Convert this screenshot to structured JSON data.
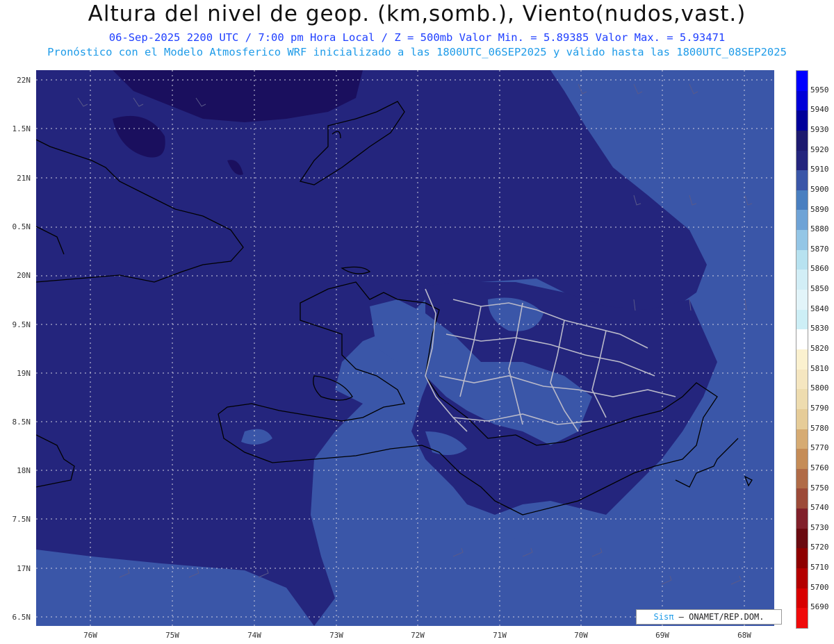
{
  "title": "Altura del nivel de geop. (km,somb.), Viento(nudos,vast.)",
  "subtitle_line1": "06-Sep-2025  2200 UTC / 7:00 pm Hora Local / Z = 500mb    Valor Min. = 5.89385  Valor Max. = 5.93471",
  "subtitle_line2": "Pronóstico con el Modelo Atmosferico WRF inicializado a las 1800UTC_06SEP2025 y válido hasta las  1800UTC_08SEP2025",
  "latitude_labels": [
    "22N",
    "1.5N",
    "21N",
    "0.5N",
    "20N",
    "9.5N",
    "19N",
    "8.5N",
    "18N",
    "7.5N",
    "17N",
    "6.5N"
  ],
  "longitude_labels": [
    "76W",
    "75W",
    "74W",
    "73W",
    "72W",
    "71W",
    "70W",
    "69W",
    "68W"
  ],
  "colorbar": {
    "levels": [
      "5950",
      "5940",
      "5930",
      "5920",
      "5910",
      "5900",
      "5890",
      "5880",
      "5870",
      "5860",
      "5850",
      "5840",
      "5830",
      "5820",
      "5810",
      "5800",
      "5790",
      "5780",
      "5770",
      "5760",
      "5750",
      "5740",
      "5730",
      "5720",
      "5710",
      "5700",
      "5690"
    ],
    "colors": [
      "#0000ff",
      "#0000d8",
      "#00009a",
      "#1d1a6f",
      "#24257d",
      "#3a56a8",
      "#4a7fc0",
      "#6fa3d6",
      "#94c6e6",
      "#b7e2f0",
      "#d2eef6",
      "#e2f4f9",
      "#cdeff6",
      "#ffffff",
      "#fbf1cf",
      "#f5e6c0",
      "#eedcaf",
      "#e6cc98",
      "#d6ab73",
      "#c58c57",
      "#b06b47",
      "#9c4a38",
      "#80202a",
      "#6a0a10",
      "#8e0000",
      "#b40000",
      "#d80000",
      "#f00a0a"
    ]
  },
  "credit": {
    "brand": "Sisπ",
    "text": "– ONAMET/REP.DOM."
  },
  "map_colors": {
    "ocean_high": "#24257d",
    "light_band": "#3a56a8",
    "darkest": "#1a0f5e",
    "coast": "#000000",
    "provinces": "#b9b9c9"
  }
}
